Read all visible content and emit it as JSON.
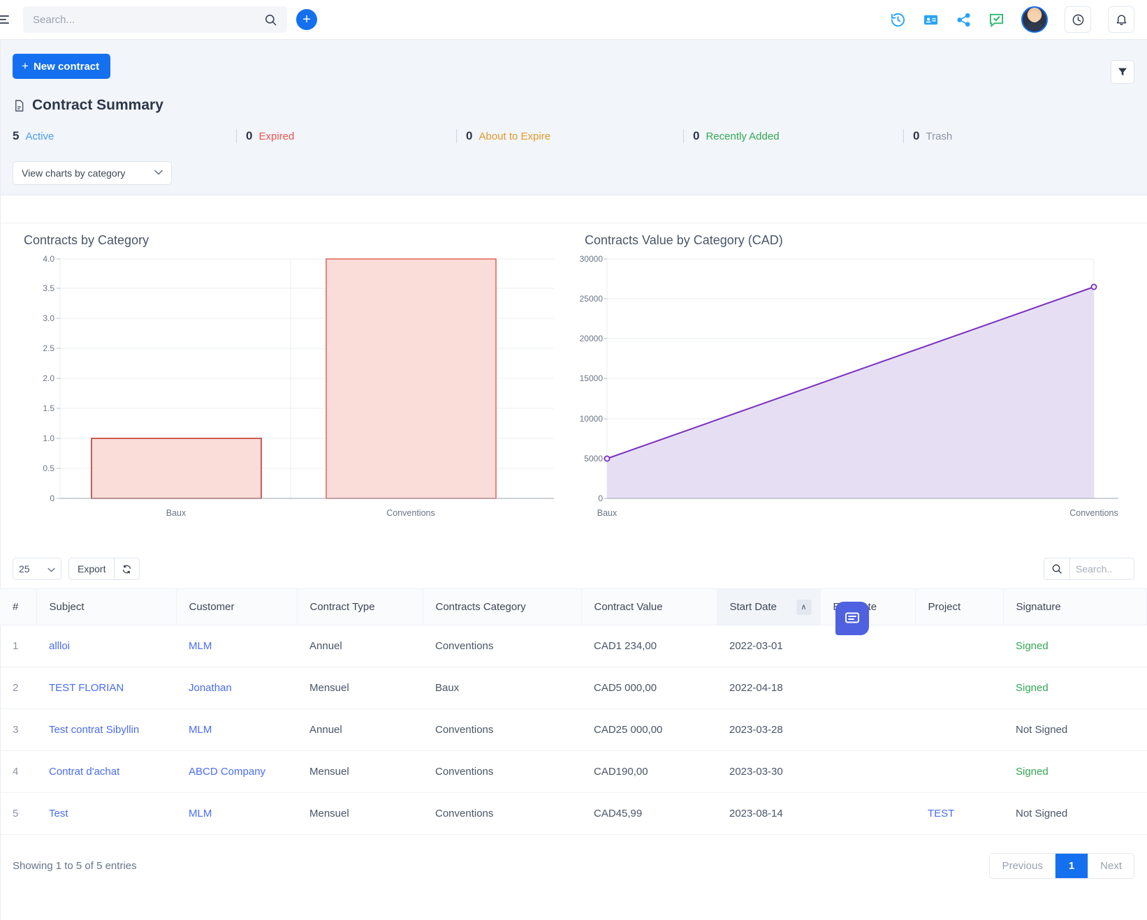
{
  "topbar": {
    "menu_icon": "hamburger-icon",
    "search_placeholder": "Search...",
    "search_value": "",
    "add_label": "+",
    "icons": [
      "history-icon",
      "contact-card-icon",
      "share-icon",
      "chat-check-icon",
      "clock-icon",
      "bell-icon"
    ]
  },
  "toolbar": {
    "new_contract_label": "New contract",
    "new_contract_plus": "+",
    "filter_icon": "filter-icon"
  },
  "summary": {
    "title": "Contract Summary",
    "title_icon": "document-icon",
    "stats": [
      {
        "count": "5",
        "label": "Active",
        "color": "#4a9df5"
      },
      {
        "count": "0",
        "label": "Expired",
        "color": "#ef5350"
      },
      {
        "count": "0",
        "label": "About to Expire",
        "color": "#e09b2d"
      },
      {
        "count": "0",
        "label": "Recently Added",
        "color": "#34a853"
      },
      {
        "count": "0",
        "label": "Trash",
        "color": "#8b94a3"
      }
    ],
    "chart_select_value": "View charts by category",
    "chart_select_caret": "⌄"
  },
  "chart_data": [
    {
      "type": "bar",
      "title": "Contracts by Category",
      "categories": [
        "Baux",
        "Conventions"
      ],
      "values": [
        1,
        4
      ],
      "xlabel": "",
      "ylabel": "",
      "ylim": [
        0,
        4.0
      ],
      "yticks": [
        "0",
        "0.5",
        "1.0",
        "1.5",
        "2.0",
        "2.5",
        "3.0",
        "3.5",
        "4.0"
      ],
      "grid": true,
      "legend": "none",
      "bar_fill": "#fadcd9",
      "bar_stroke": "#c0392b"
    },
    {
      "type": "area",
      "title": "Contracts Value by Category (CAD)",
      "categories": [
        "Baux",
        "Conventions"
      ],
      "values": [
        5000,
        26470
      ],
      "xlabel": "",
      "ylabel": "",
      "ylim": [
        0,
        30000
      ],
      "yticks": [
        "0",
        "5000",
        "10000",
        "15000",
        "20000",
        "25000",
        "30000"
      ],
      "grid": true,
      "legend": "none",
      "area_fill": "#e6dff4",
      "line_stroke": "#7b2fbe"
    }
  ],
  "table_controls": {
    "page_length": "25",
    "page_length_caret": "⌄",
    "export_label": "Export",
    "refresh_icon": "refresh-icon",
    "search_icon": "search-icon",
    "search_placeholder": "Search..",
    "search_value": ""
  },
  "table": {
    "columns": [
      "#",
      "Subject",
      "Customer",
      "Contract Type",
      "Contracts Category",
      "Contract Value",
      "Start Date",
      "End Date",
      "Project",
      "Signature"
    ],
    "sorted_column": "Start Date",
    "sort_direction_icon": "∧",
    "rows": [
      {
        "n": "1",
        "subject": "allloi",
        "customer": "MLM",
        "type": "Annuel",
        "category": "Conventions",
        "value": "CAD1 234,00",
        "start": "2022-03-01",
        "end": "",
        "project": "",
        "signature": "Signed",
        "signed": true
      },
      {
        "n": "2",
        "subject": "TEST FLORIAN",
        "customer": "Jonathan",
        "type": "Mensuel",
        "category": "Baux",
        "value": "CAD5 000,00",
        "start": "2022-04-18",
        "end": "",
        "project": "",
        "signature": "Signed",
        "signed": true
      },
      {
        "n": "3",
        "subject": "Test contrat Sibyllin",
        "customer": "MLM",
        "type": "Annuel",
        "category": "Conventions",
        "value": "CAD25 000,00",
        "start": "2023-03-28",
        "end": "",
        "project": "",
        "signature": "Not Signed",
        "signed": false
      },
      {
        "n": "4",
        "subject": "Contrat d'achat",
        "customer": "ABCD Company",
        "type": "Mensuel",
        "category": "Conventions",
        "value": "CAD190,00",
        "start": "2023-03-30",
        "end": "",
        "project": "",
        "signature": "Signed",
        "signed": true
      },
      {
        "n": "5",
        "subject": "Test",
        "customer": "MLM",
        "type": "Mensuel",
        "category": "Conventions",
        "value": "CAD45,99",
        "start": "2023-08-14",
        "end": "",
        "project": "TEST",
        "signature": "Not Signed",
        "signed": false
      }
    ]
  },
  "footer": {
    "showing": "Showing 1 to 5 of 5 entries",
    "previous": "Previous",
    "page": "1",
    "next": "Next"
  },
  "chat": {
    "icon": "chat-icon"
  }
}
